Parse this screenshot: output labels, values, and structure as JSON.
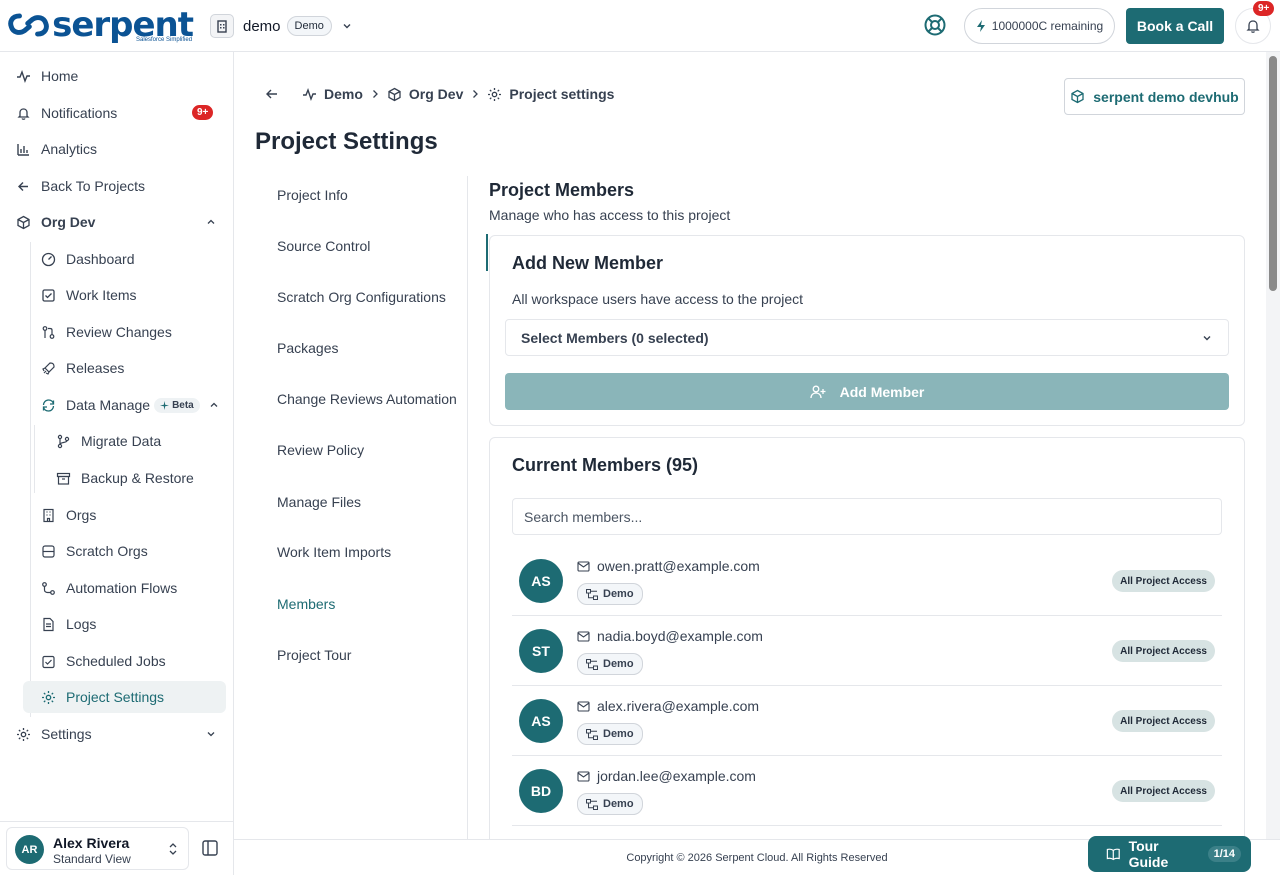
{
  "header": {
    "logo_text": "serpent",
    "logo_sub": "Salesforce Simplified",
    "workspace_name": "demo",
    "workspace_pill": "Demo",
    "credits": "1000000C remaining",
    "book_call": "Book a Call",
    "notif_badge": "9+"
  },
  "sidebar": {
    "home": "Home",
    "notifications": "Notifications",
    "notifications_badge": "9+",
    "analytics": "Analytics",
    "back": "Back To Projects",
    "org": "Org Dev",
    "items": {
      "dashboard": "Dashboard",
      "work_items": "Work Items",
      "review_changes": "Review Changes",
      "releases": "Releases",
      "data_management": "Data Manage",
      "beta": "Beta",
      "migrate_data": "Migrate Data",
      "backup_restore": "Backup & Restore",
      "orgs": "Orgs",
      "scratch_orgs": "Scratch Orgs",
      "automation_flows": "Automation Flows",
      "logs": "Logs",
      "scheduled_jobs": "Scheduled Jobs",
      "project_settings": "Project Settings"
    },
    "settings": "Settings",
    "user": {
      "initials": "AR",
      "name": "Alex Rivera",
      "view": "Standard View"
    }
  },
  "breadcrumb": {
    "project": "Demo",
    "org": "Org Dev",
    "page": "Project settings"
  },
  "org_button": "serpent demo devhub",
  "page_title": "Project Settings",
  "tabs": [
    "Project Info",
    "Source Control",
    "Scratch Org Configurations",
    "Packages",
    "Change Reviews Automation",
    "Review Policy",
    "Manage Files",
    "Work Item Imports",
    "Members",
    "Project Tour"
  ],
  "members_section": {
    "title": "Project Members",
    "subtitle": "Manage who has access to this project",
    "add": {
      "title": "Add New Member",
      "desc": "All workspace users have access to the project",
      "select": "Select Members (0 selected)",
      "button": "Add Member"
    },
    "current": {
      "title": "Current Members (95)",
      "search_placeholder": "Search members...",
      "members": [
        {
          "initials": "AS",
          "email": "owen.pratt@example.com",
          "tag": "Demo",
          "access": "All Project Access"
        },
        {
          "initials": "ST",
          "email": "nadia.boyd@example.com",
          "tag": "Demo",
          "access": "All Project Access"
        },
        {
          "initials": "AS",
          "email": "alex.rivera@example.com",
          "tag": "Demo",
          "access": "All Project Access"
        },
        {
          "initials": "BD",
          "email": "jordan.lee@example.com",
          "tag": "Demo",
          "access": "All Project Access"
        }
      ]
    }
  },
  "footer": {
    "copyright": "Copyright © 2026 Serpent Cloud. All Rights Reserved",
    "tour": "Tour Guide",
    "tour_count": "1/14"
  },
  "colors": {
    "brand": "#1d6b73",
    "logo": "#0b5394",
    "badge": "#dc2626"
  }
}
